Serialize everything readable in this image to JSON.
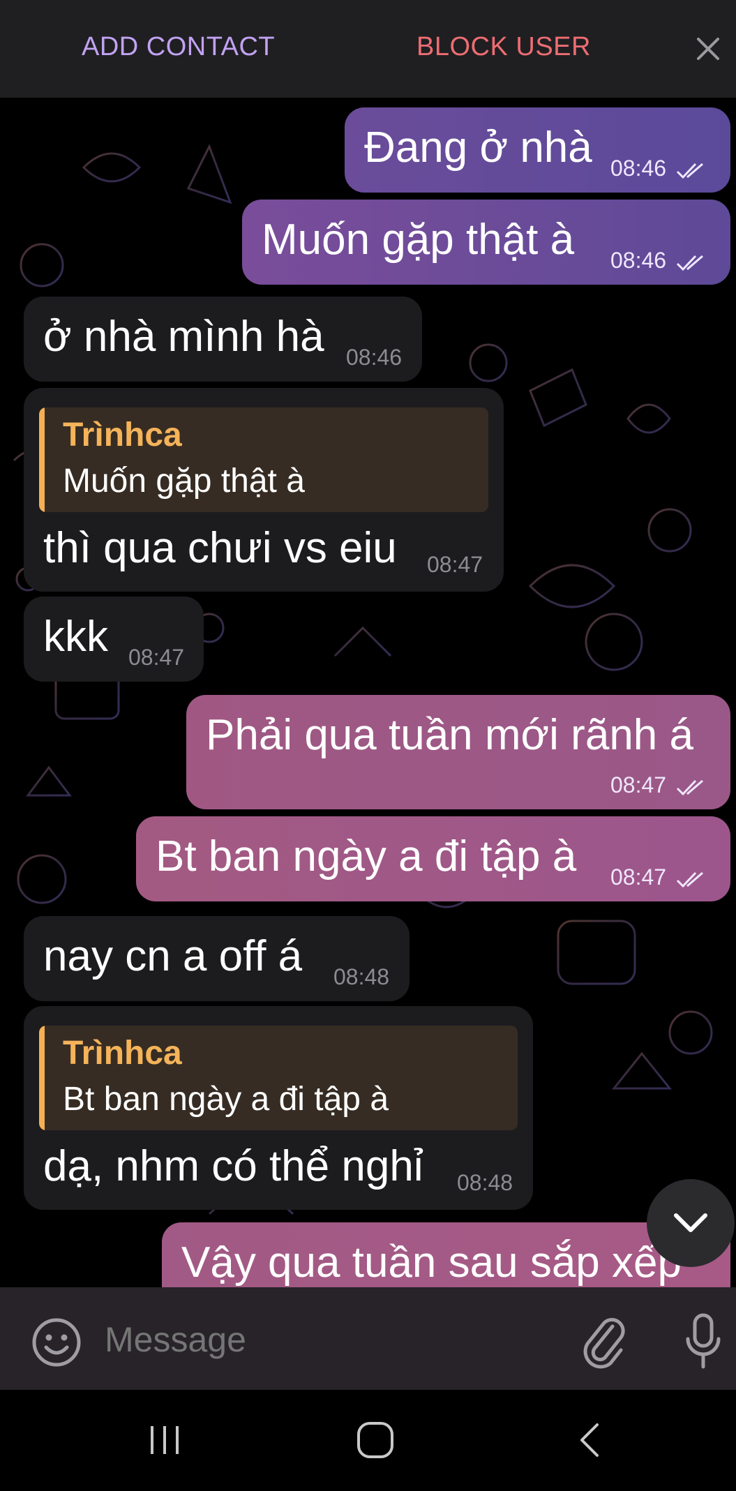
{
  "topbar": {
    "add_contact": "ADD CONTACT",
    "block_user": "BLOCK USER",
    "close_icon": "close-icon"
  },
  "colors": {
    "add_contact": "#c2a2f2",
    "block_user": "#ee6d72",
    "incoming_bubble": "#1c1c1f",
    "outgoing_gradient": [
      "#5b4a9a",
      "#a75a86"
    ],
    "reply_accent": "#f4b055"
  },
  "messages": [
    {
      "dir": "out",
      "text": "Đang ở nhà",
      "time": "08:46",
      "status": "read"
    },
    {
      "dir": "out",
      "text": "Muốn gặp thật à",
      "time": "08:46",
      "status": "read"
    },
    {
      "dir": "in",
      "text": "ở nhà mình hà",
      "time": "08:46"
    },
    {
      "dir": "in",
      "reply_name": "Trìnhca",
      "reply_text": "Muốn gặp thật à",
      "text": "thì qua chưi vs eiu",
      "time": "08:47"
    },
    {
      "dir": "in",
      "text": "kkk",
      "time": "08:47"
    },
    {
      "dir": "out",
      "text": "Phải qua tuần mới rãnh á",
      "time": "08:47",
      "status": "read"
    },
    {
      "dir": "out",
      "text": "Bt ban ngày a đi tập à",
      "time": "08:47",
      "status": "read"
    },
    {
      "dir": "in",
      "text": "nay cn a off á",
      "time": "08:48"
    },
    {
      "dir": "in",
      "reply_name": "Trìnhca",
      "reply_text": "Bt ban ngày a đi tập à",
      "text": "dạ, nhm có thể nghỉ",
      "time": "08:48"
    },
    {
      "dir": "out",
      "text": "Vậy qua tuần sau sắp xếp",
      "time": "",
      "status": ""
    }
  ],
  "input": {
    "placeholder": "Message",
    "icons": [
      "emoji-icon",
      "attach-icon",
      "mic-icon"
    ]
  },
  "scroll_button_icon": "chevron-down-icon",
  "navbar": {
    "icons": [
      "recent-apps-icon",
      "home-icon",
      "back-icon"
    ]
  }
}
